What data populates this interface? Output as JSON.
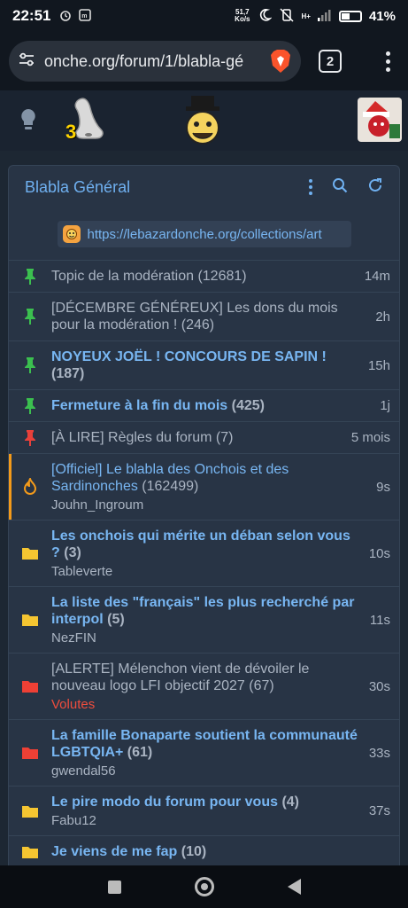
{
  "statusbar": {
    "time": "22:51",
    "net_speed_top": "51,7",
    "net_speed_bottom": "Ko/s",
    "network": "H+",
    "battery": "41%",
    "battery_level": 0.41
  },
  "browser": {
    "url": "onche.org/forum/1/blabla-gé",
    "tab_count": "2"
  },
  "header": {
    "nose_count": "3"
  },
  "forum": {
    "title": "Blabla Général",
    "link": "https://lebazardonche.org/collections/art",
    "topics": [
      {
        "title": "Topic de la modération",
        "count": "(12681)",
        "time": "14m",
        "icon": "pin-green",
        "style": "grey",
        "author": ""
      },
      {
        "title": "[DÉCEMBRE GÉNÉREUX] Les dons du mois pour la modération !",
        "count": "(246)",
        "time": "2h",
        "icon": "pin-green",
        "style": "grey",
        "author": ""
      },
      {
        "title": "NOYEUX JOËL ! CONCOURS DE SAPIN !",
        "count": "(187)",
        "time": "15h",
        "icon": "pin-green",
        "style": "bold",
        "author": ""
      },
      {
        "title": "Fermeture à la fin du mois",
        "count": "(425)",
        "time": "1j",
        "icon": "pin-green",
        "style": "bold",
        "author": ""
      },
      {
        "title": "[À LIRE] Règles du forum",
        "count": "(7)",
        "time": "5 mois",
        "icon": "pin-red",
        "style": "grey",
        "author": ""
      },
      {
        "title": "[Officiel] Le blabla des Onchois et des Sardinonches",
        "count": "(162499)",
        "time": "9s",
        "icon": "flame",
        "style": "blue",
        "author": "Jouhn_Ingroum"
      },
      {
        "title": "Les onchois qui mérite un déban selon vous ?",
        "count": "(3)",
        "time": "10s",
        "icon": "folder-yellow",
        "style": "bold",
        "author": "Tableverte"
      },
      {
        "title": "La liste des \"français\" les plus recherché par interpol",
        "count": "(5)",
        "time": "11s",
        "icon": "folder-yellow",
        "style": "bold",
        "author": "NezFIN"
      },
      {
        "title": "[ALERTE] Mélenchon vient de dévoiler le nouveau logo LFI objectif 2027",
        "count": "(67)",
        "time": "30s",
        "icon": "folder-red",
        "style": "grey",
        "author": "Volutes",
        "author_red": true
      },
      {
        "title": "La famille Bonaparte soutient la communauté LGBTQIA+",
        "count": "(61)",
        "time": "33s",
        "icon": "folder-red",
        "style": "bold",
        "author": "gwendal56"
      },
      {
        "title": "Le pire modo du forum pour vous",
        "count": "(4)",
        "time": "37s",
        "icon": "folder-yellow",
        "style": "bold",
        "author": "Fabu12"
      },
      {
        "title": "Je viens de me fap",
        "count": "(10)",
        "time": "",
        "icon": "folder-yellow",
        "style": "bold",
        "author": ""
      }
    ]
  }
}
